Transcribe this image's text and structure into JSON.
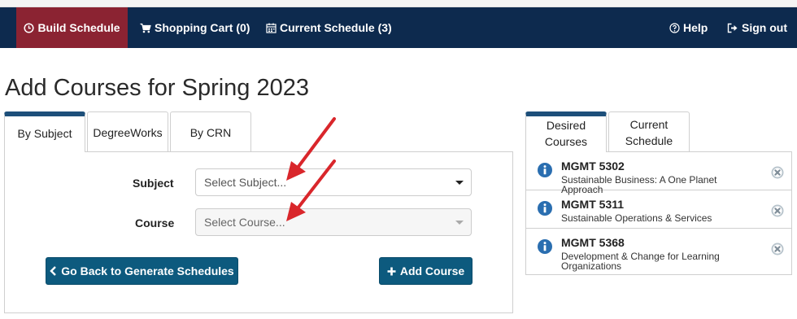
{
  "nav": {
    "build_schedule": "Build Schedule",
    "shopping_cart": "Shopping Cart (0)",
    "current_schedule": "Current Schedule (3)",
    "help": "Help",
    "sign_out": "Sign out"
  },
  "page_title": "Add Courses for Spring 2023",
  "tabs": {
    "by_subject": "By Subject",
    "degreeworks": "DegreeWorks",
    "by_crn": "By CRN"
  },
  "form": {
    "subject_label": "Subject",
    "subject_placeholder": "Select Subject...",
    "course_label": "Course",
    "course_placeholder": "Select Course...",
    "back_button": "Go Back to Generate Schedules",
    "add_course_button": "Add Course"
  },
  "side_tabs": {
    "desired_line1": "Desired",
    "desired_line2": "Courses",
    "current_line1": "Current",
    "current_line2": "Schedule"
  },
  "desired_courses": [
    {
      "code": "MGMT 5302",
      "title": "Sustainable Business: A One Planet Approach"
    },
    {
      "code": "MGMT 5311",
      "title": "Sustainable Operations & Services"
    },
    {
      "code": "MGMT 5368",
      "title": "Development & Change for Learning Organizations"
    }
  ],
  "colors": {
    "navbar": "#0d2a4e",
    "active_nav": "#8b2332",
    "primary_button": "#0d5a7e",
    "tab_accent": "#1d4f7a",
    "annotation_arrow": "#d9262b",
    "info_icon": "#2a6eb0"
  },
  "icons": {
    "build_schedule": "clock-circle-icon",
    "shopping_cart": "cart-icon",
    "current_schedule": "calendar-icon",
    "help": "question-circle-icon",
    "sign_out": "sign-out-icon",
    "back": "chevron-left-icon",
    "add": "plus-icon",
    "course_info": "info-circle-icon",
    "course_remove": "remove-circle-icon"
  }
}
